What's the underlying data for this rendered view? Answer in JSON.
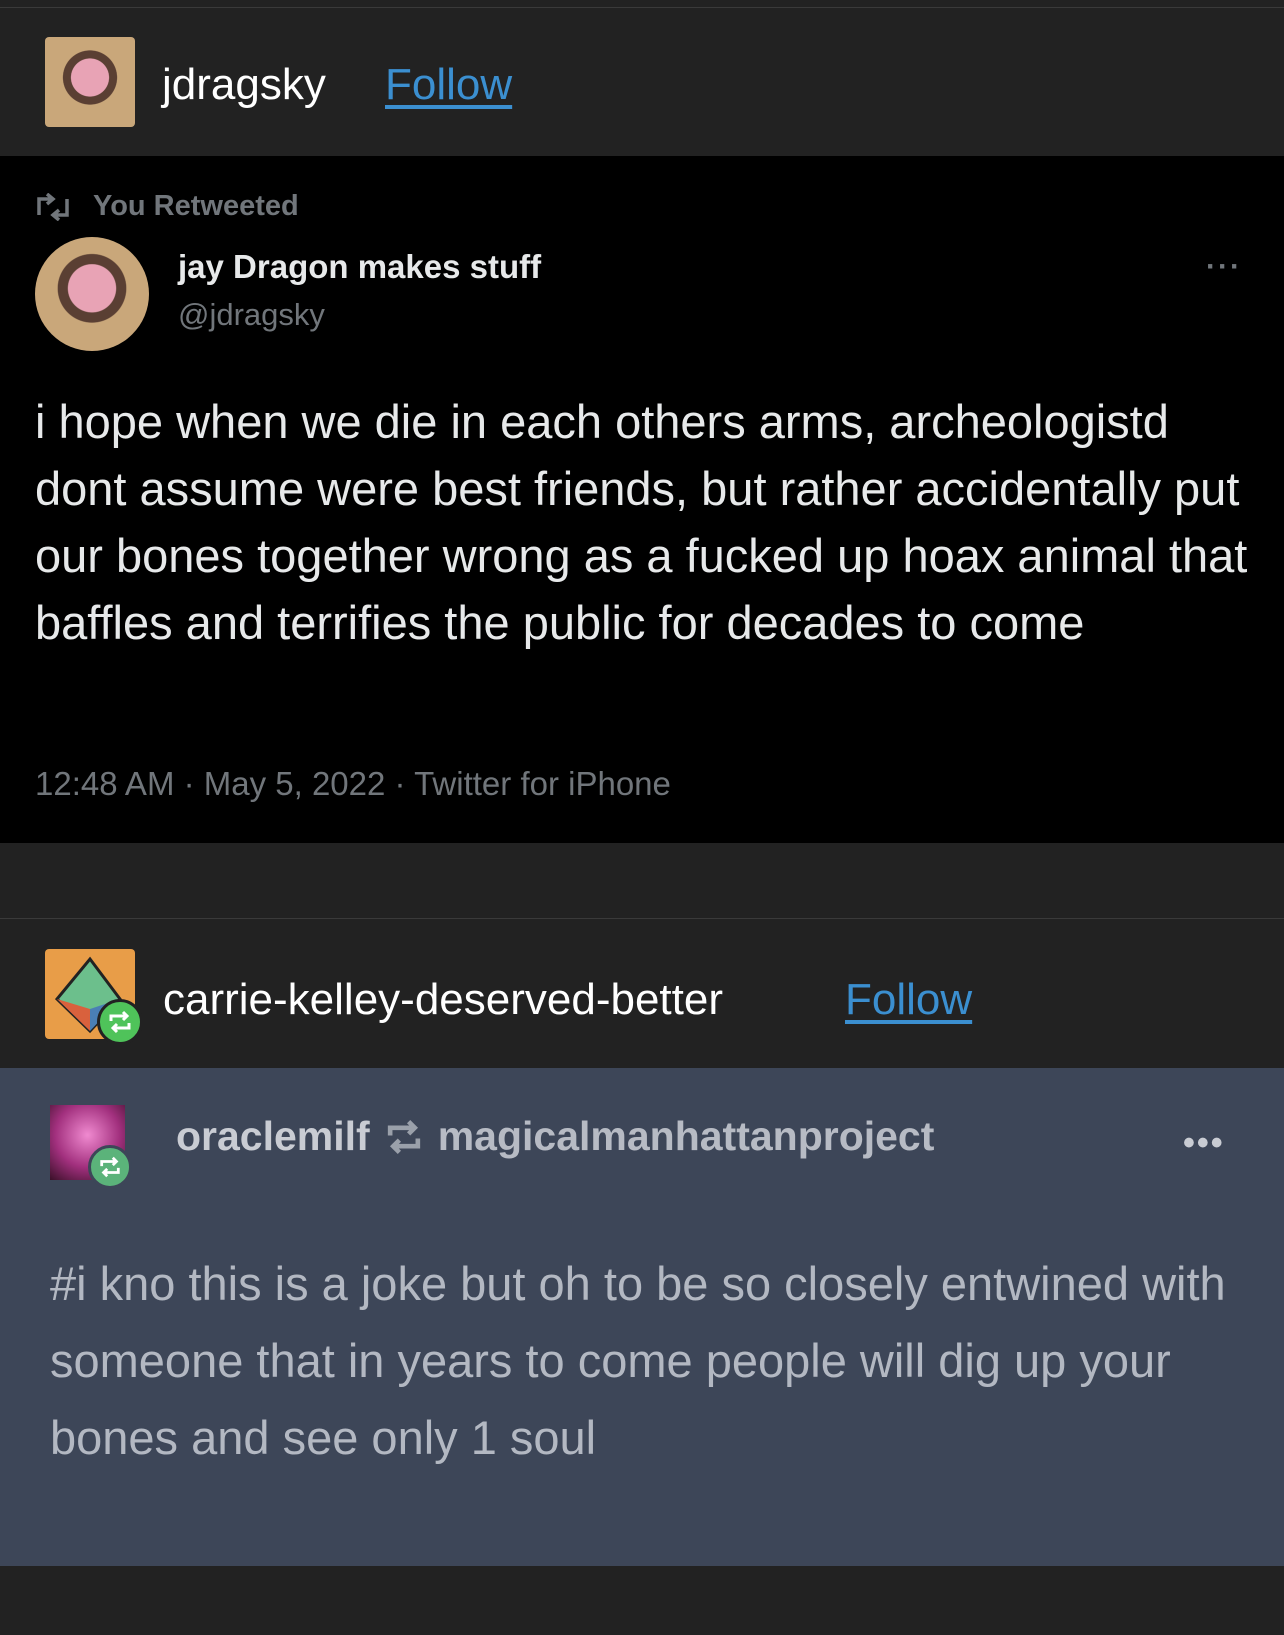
{
  "post1": {
    "username": "jdragsky",
    "follow_label": "Follow",
    "tweet": {
      "retweet_label": "You Retweeted",
      "display_name": "jay Dragon makes stuff",
      "handle": "@jdragsky",
      "text": "i hope when we die in each others arms, archeologistd dont assume were best friends, but rather accidentally put our bones together wrong as a fucked up hoax animal that baffles and terrifies the public for decades to come",
      "meta": "12:48 AM · May 5, 2022 · Twitter for iPhone",
      "more_label": "···"
    }
  },
  "post2": {
    "username": "carrie-kelley-deserved-better",
    "follow_label": "Follow",
    "reblog": {
      "user": "oraclemilf",
      "source": "magicalmanhattanproject",
      "more_label": "•••",
      "tags": "#i kno this is a joke but oh to be so closely entwined with someone that in years to come people will dig up your bones and see only 1 soul"
    }
  },
  "colors": {
    "link": "#3b8fd0",
    "reblog_green": "#4fc35a",
    "panel": "#3d4658"
  }
}
